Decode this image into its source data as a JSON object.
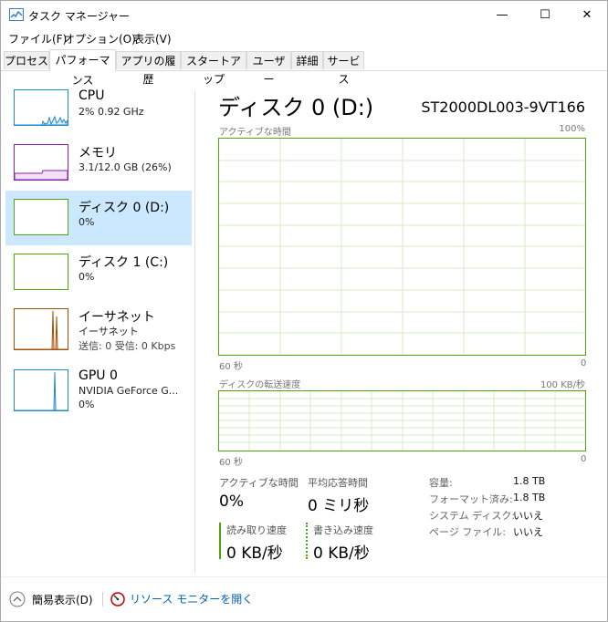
{
  "window": {
    "title": "タスク マネージャー",
    "controls": {
      "minimize": "—",
      "maximize": "☐",
      "close": "✕"
    }
  },
  "menu": [
    "ファイル(F)",
    "オプション(O)",
    "表示(V)"
  ],
  "tabs": [
    {
      "label": "プロセス",
      "active": false
    },
    {
      "label": "パフォーマンス",
      "active": true
    },
    {
      "label": "アプリの履歴",
      "active": false
    },
    {
      "label": "スタートアップ",
      "active": false
    },
    {
      "label": "ユーザー",
      "active": false
    },
    {
      "label": "詳細",
      "active": false
    },
    {
      "label": "サービス",
      "active": false
    }
  ],
  "sidebar": {
    "items": [
      {
        "title": "CPU",
        "sub1": "2%  0.92 GHz",
        "sub2": "",
        "color": "#1f8bc9"
      },
      {
        "title": "メモリ",
        "sub1": "3.1/12.0 GB (26%)",
        "sub2": "",
        "color": "#8b1fae"
      },
      {
        "title": "ディスク 0 (D:)",
        "sub1": "0%",
        "sub2": "",
        "color": "#4da60c",
        "selected": true
      },
      {
        "title": "ディスク 1 (C:)",
        "sub1": "0%",
        "sub2": "",
        "color": "#4da60c"
      },
      {
        "title": "イーサネット",
        "sub1": "イーサネット",
        "sub2": "送信: 0  受信: 0 Kbps",
        "color": "#a74f01"
      },
      {
        "title": "GPU 0",
        "sub1": "NVIDIA GeForce G...",
        "sub2": "0%",
        "color": "#1f8bc9"
      }
    ]
  },
  "main": {
    "title": "ディスク 0 (D:)",
    "model": "ST2000DL003-9VT166",
    "graph1": {
      "label": "アクティブな時間",
      "max": "100%",
      "time": "60 秒",
      "min": "0"
    },
    "graph2": {
      "label": "ディスクの転送速度",
      "max": "100 KB/秒",
      "time": "60 秒",
      "min": "0"
    },
    "stats": {
      "active_label": "アクティブな時間",
      "active_value": "0%",
      "response_label": "平均応答時間",
      "response_value": "0 ミリ秒",
      "read_label": "読み取り速度",
      "read_value": "0 KB/秒",
      "write_label": "書き込み速度",
      "write_value": "0 KB/秒"
    },
    "info": [
      {
        "label": "容量:",
        "value": "1.8 TB"
      },
      {
        "label": "フォーマット済み:",
        "value": "1.8 TB"
      },
      {
        "label": "システム ディスク:",
        "value": "いいえ"
      },
      {
        "label": "ページ ファイル:",
        "value": "いいえ"
      }
    ]
  },
  "footer": {
    "summary_label": "簡易表示(D)",
    "resource_monitor": "リソース モニターを開く"
  },
  "colors": {
    "accent": "#4da60c",
    "selected_bg": "#cce8ff",
    "link": "#0063b1"
  }
}
